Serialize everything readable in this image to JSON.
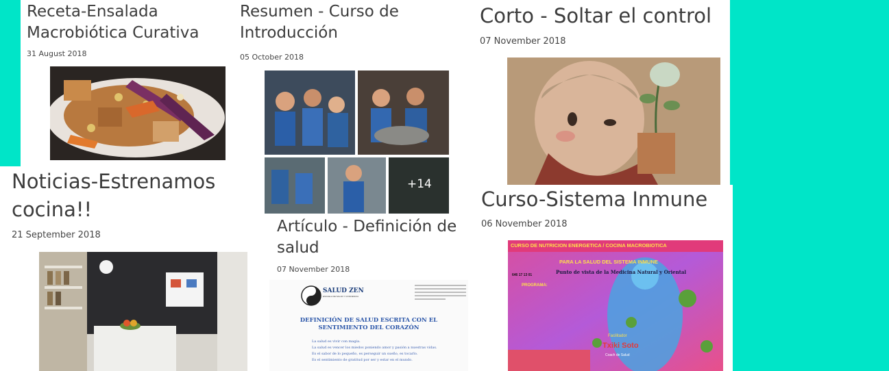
{
  "posts": [
    {
      "title": "Receta-Ensalada Macrobiótica Curativa",
      "date": "31 August 2018",
      "image": "macrobiotic-salad-photo"
    },
    {
      "title": "Resumen - Curso de Introducción",
      "date": "05 October 2018",
      "image": "cooking-course-collage",
      "more_badge": "+14"
    },
    {
      "title": "Corto - Soltar el control",
      "date": "07 November 2018",
      "image": "monk-with-plant-illustration"
    },
    {
      "title": "Noticias-Estrenamos cocina!!",
      "date": "21 September 2018",
      "image": "new-kitchen-photo"
    },
    {
      "title": "Artículo - Definición de salud",
      "date": "07 November 2018",
      "image": "health-definition-document",
      "doc": {
        "logo": "SALUD ZEN",
        "logo_sub": "ESCUELA DE SALUD Y CONCIENCIA",
        "heading_1": "DEFINICIÓN DE SALUD ESCRITA CON EL",
        "heading_2": "SENTIMIENTO DEL CORAZÓN",
        "lines": [
          "La salud es vivir con magia.",
          "La salud es vencer los miedos poniendo amor y pasión a nuestras vidas.",
          "Es el sabor de lo pequeño, es perseguir un sueño, es tocarlo.",
          "Es el sentimiento de gratitud por ser y estar en el mundo."
        ]
      }
    },
    {
      "title": "Curso-Sistema Inmune",
      "date": "06 November 2018",
      "image": "immune-system-course-poster",
      "poster": {
        "top": "CURSO DE NUTRICION ENERGETICA / COCINA MACROBIOTICA",
        "sub": "PARA LA SALUD DEL SISTEMA INMUNE",
        "line": "Punto de vista de la Medicina Natural y Oriental",
        "phone": "646 17 13 01",
        "program": "PROGRAMA:",
        "facilitator": "Facilitador",
        "name": "Txiki Soto",
        "role": "Coach de Salud"
      }
    }
  ]
}
